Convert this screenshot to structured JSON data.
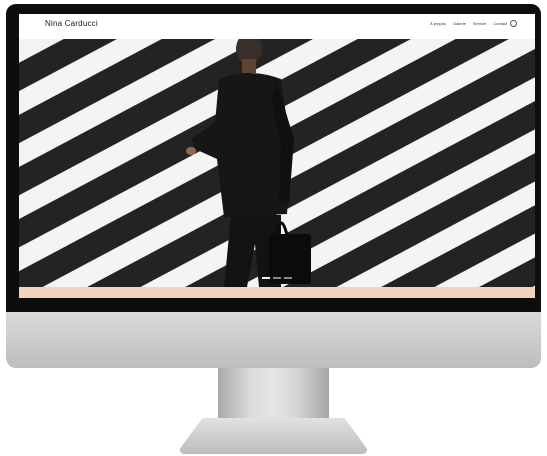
{
  "site": {
    "title": "Nina Carducci",
    "nav": [
      "À propos",
      "Galerie",
      "Service",
      "Contact"
    ],
    "nav_icon": "instagram-icon"
  },
  "hero": {
    "slides": 3,
    "active_slide": 1
  },
  "colors": {
    "bezel": "#0d0d0d",
    "accent_band": "#f3d2c0",
    "chin": "#d1d1d1"
  }
}
